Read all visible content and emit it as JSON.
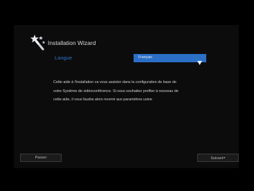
{
  "wizard": {
    "title": "Installation Wizard",
    "icon": "magic-wand-icon"
  },
  "language": {
    "label": "Langue",
    "selected": "Français",
    "arrow_icon": "triangle-down-icon"
  },
  "description": {
    "lines": [
      "Cette aide à l'installation va vous assister dans la configuration de base de",
      "votre Système de vidéoconférence. Si vous souhaitez profiter à nouveau de",
      "cette aide, il vous faudra alors revenir aux paramètres usine"
    ]
  },
  "buttons": {
    "skip_label": "Passer",
    "next_label": "Suivant",
    "next_icon": "arrow-right-icon"
  },
  "colors": {
    "accent_blue": "#2b6fc7",
    "label_blue": "#2f76c9",
    "background": "#000000",
    "panel": "#0c0c0c"
  }
}
